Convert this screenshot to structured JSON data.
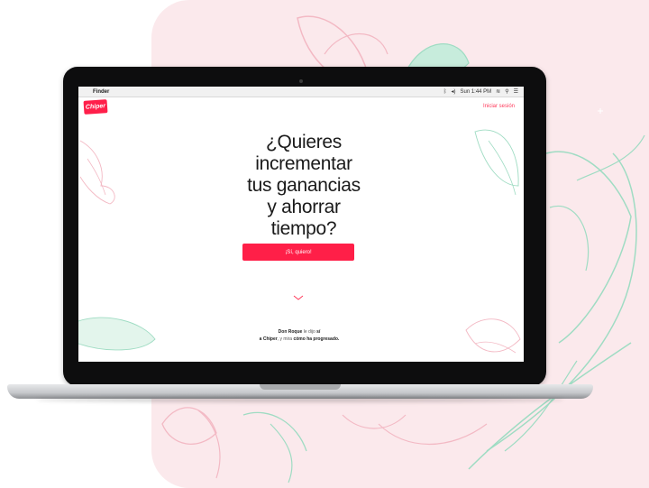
{
  "menubar": {
    "apple_icon": "apple-icon",
    "app_name": "Finder",
    "clock": "Sun 1:44 PM",
    "right_icons": [
      "bluetooth-icon",
      "volume-icon",
      "wifi-icon",
      "search-icon",
      "list-icon"
    ]
  },
  "header": {
    "logo_text": "Chiper",
    "login_label": "Iniciar sesión"
  },
  "hero": {
    "line1": "¿Quieres",
    "line2": "incrementar",
    "line3": "tus ganancias",
    "line4": "y ahorrar",
    "line5": "tiempo?",
    "cta_label": "¡Sí, quiero!"
  },
  "testimonial": {
    "name": "Don Roque",
    "text1": " le dijo ",
    "text2": "sí",
    "text3": "a Chiper",
    "text4": ", y mira ",
    "text5": "cómo ha progresado."
  },
  "colors": {
    "brand": "#ff1f48",
    "background_blob": "#fbe9ec",
    "leaf_green": "#9fdcc3",
    "leaf_pink": "#f3b9c4"
  }
}
